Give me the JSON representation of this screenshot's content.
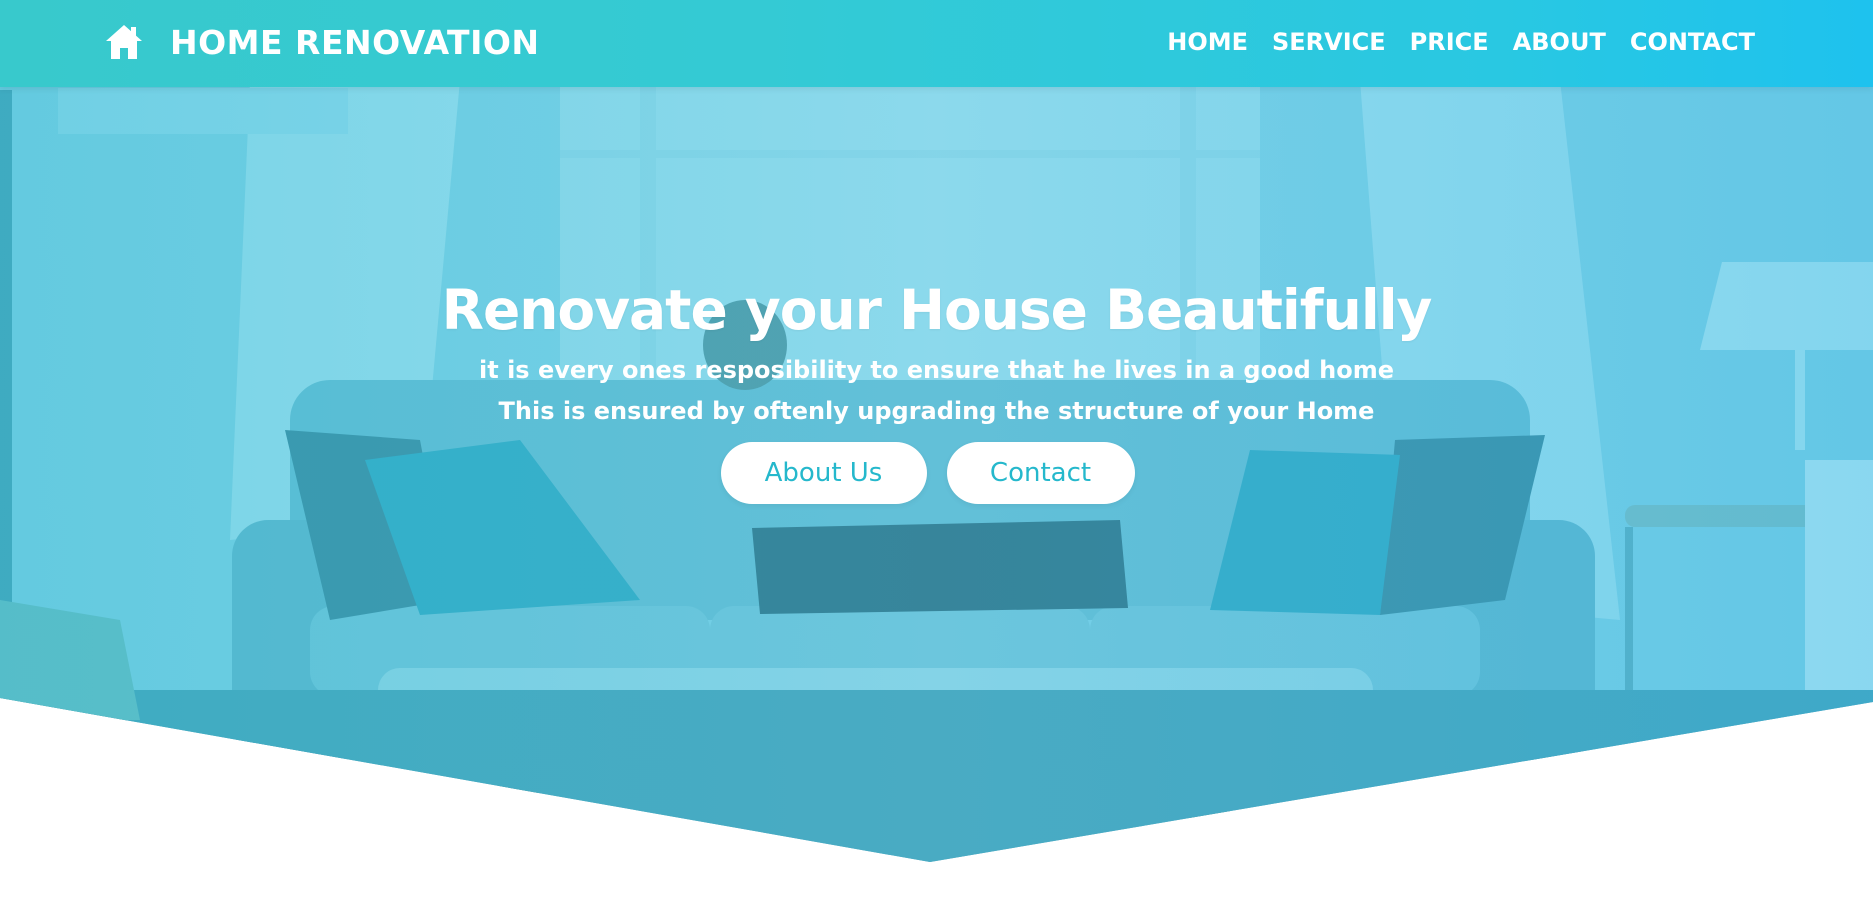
{
  "brand": {
    "name": "HOME RENOVATION",
    "icon": "home-icon"
  },
  "nav": {
    "items": [
      "HOME",
      "SERVICE",
      "PRICE",
      "ABOUT",
      "CONTACT"
    ]
  },
  "hero": {
    "title": "Renovate your House Beautifully",
    "subtitle_line1": "it is every ones resposibility to ensure that he lives in a good home",
    "subtitle_line2": "This is ensured by oftenly upgrading the structure of your Home",
    "buttons": {
      "about": "About Us",
      "contact": "Contact"
    }
  },
  "colors": {
    "nav_gradient_start": "#38c9cc",
    "nav_gradient_end": "#1ec2ee",
    "hero_tint": "#4ec6e0",
    "button_text": "#25b8cc",
    "white": "#ffffff"
  }
}
